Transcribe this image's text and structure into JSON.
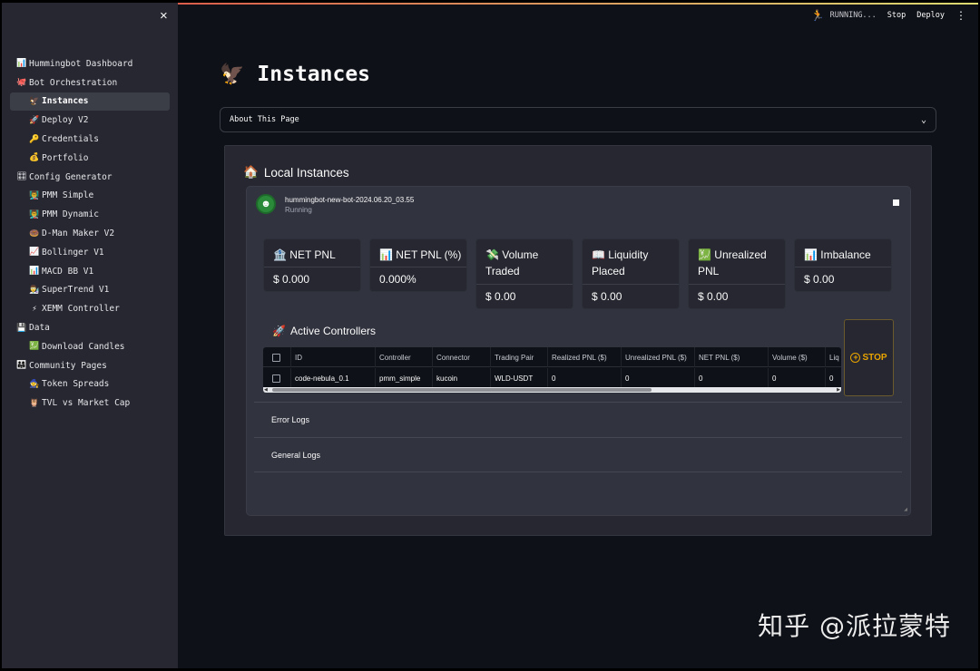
{
  "header": {
    "status": "RUNNING...",
    "stop_label": "Stop",
    "deploy_label": "Deploy",
    "more_icon": "⋮"
  },
  "sidebar": {
    "close_icon": "×",
    "items": [
      {
        "icon": "📊",
        "label": "Hummingbot Dashboard"
      },
      {
        "icon": "🐙",
        "label": "Bot Orchestration"
      },
      {
        "icon": "🦅",
        "label": "Instances"
      },
      {
        "icon": "🚀",
        "label": "Deploy V2"
      },
      {
        "icon": "🔑",
        "label": "Credentials"
      },
      {
        "icon": "💰",
        "label": "Portfolio"
      },
      {
        "icon": "🎛",
        "label": "Config Generator"
      },
      {
        "icon": "👨‍🏫",
        "label": "PMM Simple"
      },
      {
        "icon": "👨‍🏫",
        "label": "PMM Dynamic"
      },
      {
        "icon": "🍩",
        "label": "D-Man Maker V2"
      },
      {
        "icon": "📈",
        "label": "Bollinger V1"
      },
      {
        "icon": "📊",
        "label": "MACD BB V1"
      },
      {
        "icon": "👨‍🔬",
        "label": "SuperTrend V1"
      },
      {
        "icon": "⚡",
        "label": "XEMM Controller"
      },
      {
        "icon": "💾",
        "label": "Data"
      },
      {
        "icon": "💹",
        "label": "Download Candles"
      },
      {
        "icon": "👨‍👩‍👧",
        "label": "Community Pages"
      },
      {
        "icon": "🧙",
        "label": "Token Spreads"
      },
      {
        "icon": "🦉",
        "label": "TVL vs Market Cap"
      }
    ]
  },
  "page": {
    "title": "Instances",
    "title_icon": "🦅",
    "expander_label": "About This Page",
    "expander_icon": "⌄"
  },
  "local_instances": {
    "title": "Local Instances",
    "title_icon": "🏠",
    "bot_name": "hummingbot-new-bot-2024.06.20_03.55",
    "bot_status": "Running",
    "metrics": [
      {
        "icon": "🏦",
        "label": "NET PNL",
        "value": "$ 0.000"
      },
      {
        "icon": "📊",
        "label": "NET PNL (%)",
        "value": "0.000%"
      },
      {
        "icon": "💸",
        "label": "Volume Traded",
        "value": "$ 0.00"
      },
      {
        "icon": "📖",
        "label": "Liquidity Placed",
        "value": "$ 0.00"
      },
      {
        "icon": "💹",
        "label": "Unrealized PNL",
        "value": "$ 0.00"
      },
      {
        "icon": "📊",
        "label": "Imbalance",
        "value": "$ 0.00"
      }
    ],
    "active_controllers": {
      "title": "Active Controllers",
      "title_icon": "🚀",
      "columns": [
        "ID",
        "Controller",
        "Connector",
        "Trading Pair",
        "Realized PNL ($)",
        "Unrealized PNL ($)",
        "NET PNL ($)",
        "Volume ($)",
        "Liq"
      ],
      "rows": [
        [
          "code-nebula_0.1",
          "pmm_simple",
          "kucoin",
          "WLD-USDT",
          "0",
          "0",
          "0",
          "0",
          "0"
        ]
      ]
    },
    "stop_button": "STOP",
    "error_logs": "Error Logs",
    "general_logs": "General Logs"
  },
  "watermark": "知乎 @派拉蒙特"
}
